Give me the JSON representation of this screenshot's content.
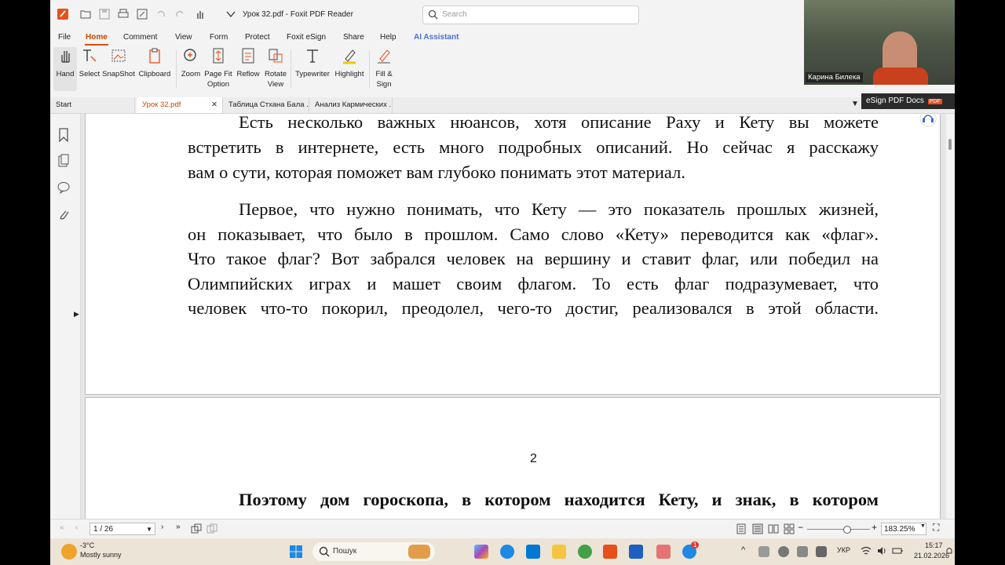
{
  "app": {
    "title": "Урок 32.pdf - Foxit PDF Reader",
    "search_placeholder": "Search"
  },
  "menu": [
    "File",
    "Home",
    "Comment",
    "View",
    "Form",
    "Protect",
    "Foxit eSign",
    "Share",
    "Help",
    "AI Assistant"
  ],
  "ribbon": {
    "hand": "Hand",
    "select": "Select",
    "snapshot": "SnapShot",
    "clipboard": "Clipboard",
    "zoom": "Zoom",
    "pagefit_1": "Page Fit",
    "pagefit_2": "Option",
    "reflow": "Reflow",
    "rotate_1": "Rotate",
    "rotate_2": "View",
    "typewriter": "Typewriter",
    "highlight": "Highlight",
    "fillsign_1": "Fill &",
    "fillsign_2": "Sign"
  },
  "tabs": [
    "Start",
    "Урок 32.pdf",
    "Таблица Стхана Бала ...",
    "Анализ Кармических ..."
  ],
  "esign": "eSign PDF Docs",
  "esign_badge": "PDF",
  "webcam_name": "Карина Билека",
  "doc": {
    "p1": [
      "Есть несколько важных нюансов, хотя описание Раху и Кету вы можете",
      "встретить в интернете, есть много подробных описаний. Но сейчас я расскажу",
      "вам о сути, которая поможет вам глубоко понимать этот материал."
    ],
    "p2": [
      "Первое, что нужно понимать, что Кету — это показатель прошлых жизней,",
      "он показывает, что было в прошлом. Само слово «Кету» переводится как «флаг».",
      "Что такое флаг? Вот забрался человек на вершину и ставит флаг, или победил на",
      "Олимпийских играх и машет своим флагом. То есть флаг подразумевает, что",
      "человек что-то покорил, преодолел, чего-то достиг, реализовался в этой области."
    ],
    "page2_number": "2",
    "page2_heading": "Поэтому дом гороскопа, в котором находится Кету, и знак, в котором"
  },
  "status": {
    "page": "1 / 26",
    "zoom": "183.25%"
  },
  "taskbar": {
    "temp": "-3°C",
    "weather": "Mostly sunny",
    "search": "Пошук",
    "lang": "УКР",
    "time": "15:17",
    "date": "21.02.2026",
    "badge": "1"
  },
  "colors": {
    "accent": "#d35400",
    "ai": "#4a6fd6"
  }
}
